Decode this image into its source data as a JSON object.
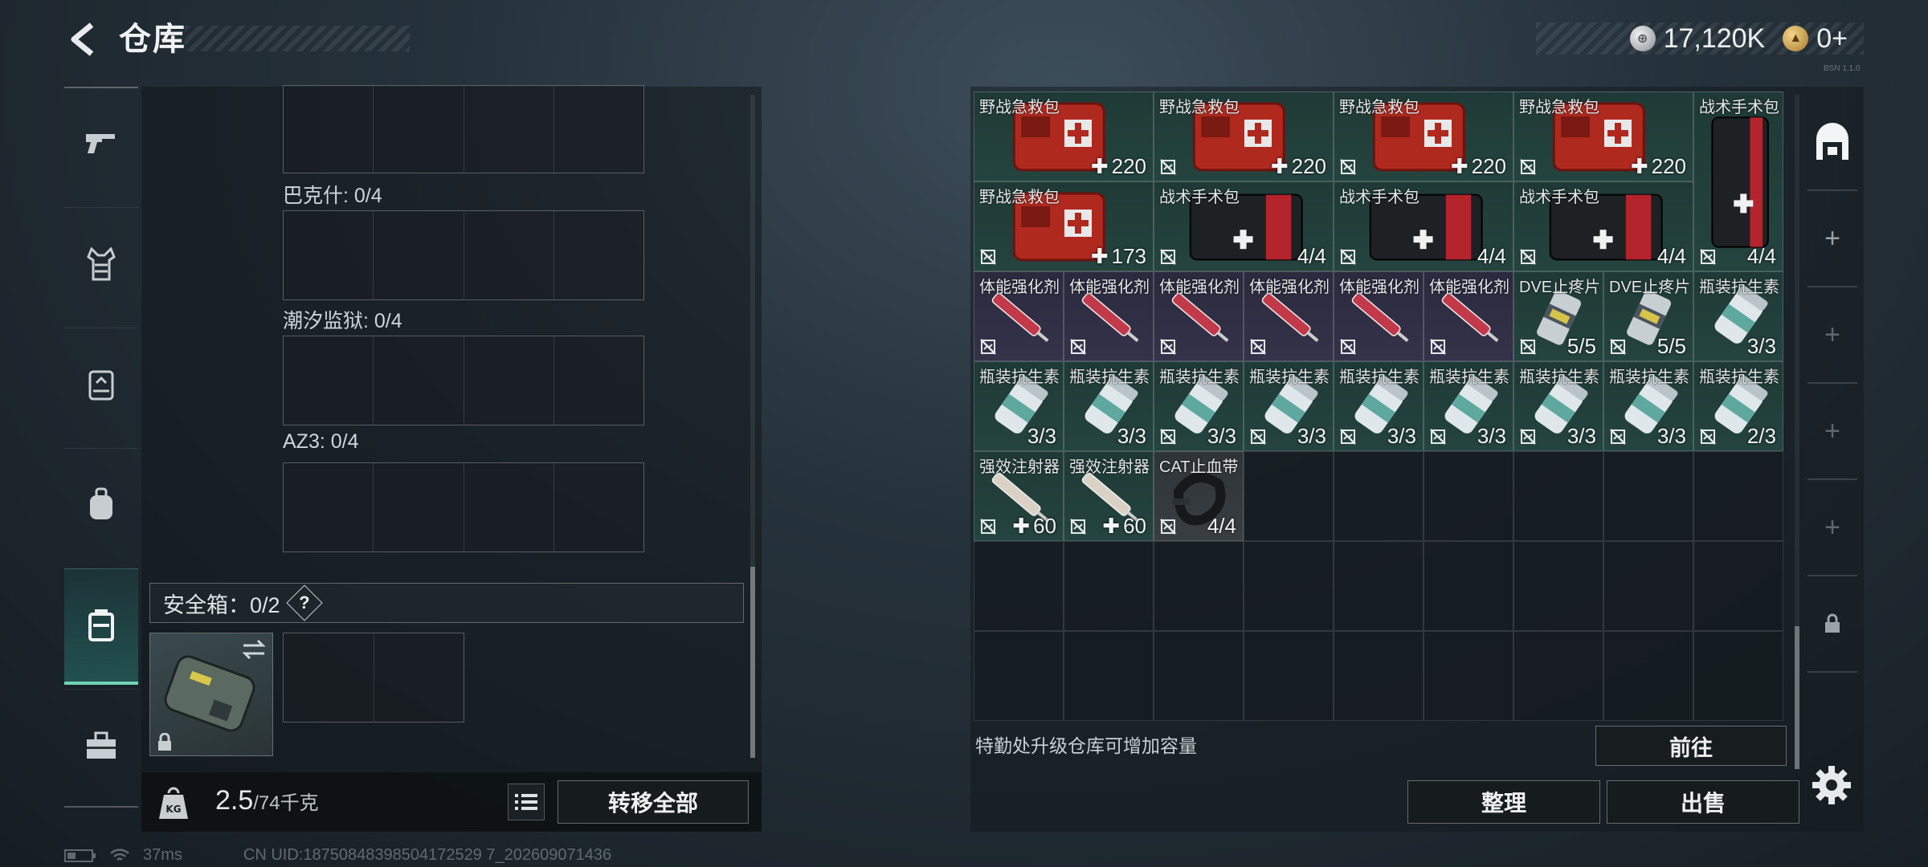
{
  "header": {
    "title": "仓库",
    "silver_amount": "17,120K",
    "gold_amount": "0+",
    "version": "BSN 1.1.0"
  },
  "left": {
    "groups": [
      {
        "label": ""
      },
      {
        "label": "巴克什: 0/4"
      },
      {
        "label": "潮汐监狱: 0/4"
      },
      {
        "label": "AZ3: 0/4"
      }
    ],
    "safe_box_label": "安全箱：0/2",
    "help": "?",
    "weight_value": "2.5",
    "weight_max": "/74千克",
    "transfer_all": "转移全部"
  },
  "right": {
    "upgrade_hint": "特勤处升级仓库可增加容量",
    "goto": "前往",
    "sort": "整理",
    "sell": "出售",
    "items": [
      {
        "name": "野战急救包",
        "count": "220",
        "plus": true,
        "lock": false
      },
      {
        "name": "野战急救包",
        "count": "220",
        "plus": true,
        "lock": true
      },
      {
        "name": "野战急救包",
        "count": "220",
        "plus": true,
        "lock": true
      },
      {
        "name": "野战急救包",
        "count": "220",
        "plus": true,
        "lock": true
      },
      {
        "name": "战术手术包",
        "count": "4/4",
        "plus": false,
        "lock": true
      },
      {
        "name": "野战急救包",
        "count": "173",
        "plus": true,
        "lock": true
      },
      {
        "name": "战术手术包",
        "count": "4/4",
        "plus": false,
        "lock": true
      },
      {
        "name": "战术手术包",
        "count": "4/4",
        "plus": false,
        "lock": true
      },
      {
        "name": "战术手术包",
        "count": "4/4",
        "plus": false,
        "lock": true
      },
      {
        "name": "体能强化剂",
        "count": "",
        "plus": false,
        "lock": true
      },
      {
        "name": "体能强化剂",
        "count": "",
        "plus": false,
        "lock": true
      },
      {
        "name": "体能强化剂",
        "count": "",
        "plus": false,
        "lock": true
      },
      {
        "name": "体能强化剂",
        "count": "",
        "plus": false,
        "lock": true
      },
      {
        "name": "体能强化剂",
        "count": "",
        "plus": false,
        "lock": true
      },
      {
        "name": "体能强化剂",
        "count": "",
        "plus": false,
        "lock": true
      },
      {
        "name": "DVE止疼片",
        "count": "5/5",
        "plus": false,
        "lock": true
      },
      {
        "name": "DVE止疼片",
        "count": "5/5",
        "plus": false,
        "lock": true
      },
      {
        "name": "瓶装抗生素",
        "count": "3/3",
        "plus": false,
        "lock": false
      },
      {
        "name": "瓶装抗生素",
        "count": "3/3",
        "plus": false,
        "lock": false
      },
      {
        "name": "瓶装抗生素",
        "count": "3/3",
        "plus": false,
        "lock": false
      },
      {
        "name": "瓶装抗生素",
        "count": "3/3",
        "plus": false,
        "lock": true
      },
      {
        "name": "瓶装抗生素",
        "count": "3/3",
        "plus": false,
        "lock": true
      },
      {
        "name": "瓶装抗生素",
        "count": "3/3",
        "plus": false,
        "lock": true
      },
      {
        "name": "瓶装抗生素",
        "count": "3/3",
        "plus": false,
        "lock": true
      },
      {
        "name": "瓶装抗生素",
        "count": "3/3",
        "plus": false,
        "lock": true
      },
      {
        "name": "瓶装抗生素",
        "count": "3/3",
        "plus": false,
        "lock": true
      },
      {
        "name": "瓶装抗生素",
        "count": "2/3",
        "plus": false,
        "lock": true
      },
      {
        "name": "强效注射器",
        "count": "60",
        "plus": true,
        "lock": true
      },
      {
        "name": "强效注射器",
        "count": "60",
        "plus": true,
        "lock": true
      },
      {
        "name": "CAT止血带",
        "count": "4/4",
        "plus": false,
        "lock": true
      }
    ]
  },
  "status": {
    "ping": "37ms",
    "uid": "CN UID:18750848398504172529 7_202609071436"
  }
}
